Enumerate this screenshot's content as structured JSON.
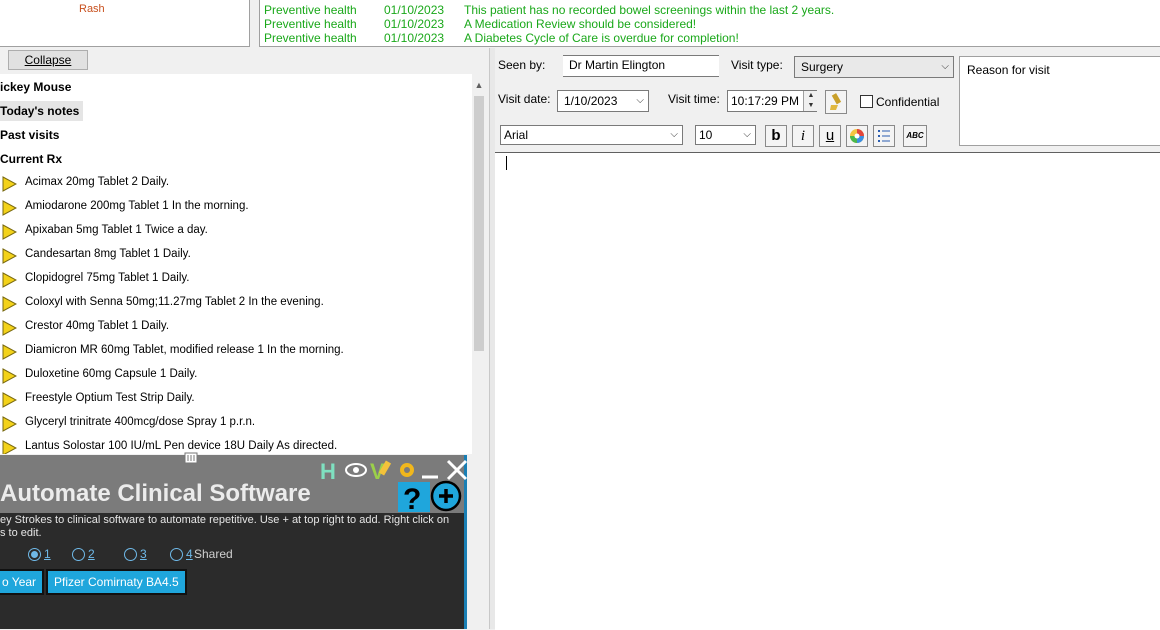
{
  "rash": "Rash",
  "reminders": [
    {
      "category": "Preventive health",
      "date": "01/10/2023",
      "message": "This patient has no recorded bowel screenings within the last 2 years."
    },
    {
      "category": "Preventive health",
      "date": "01/10/2023",
      "message": "A Medication Review should be considered!"
    },
    {
      "category": "Preventive health",
      "date": "01/10/2023",
      "message": "A Diabetes Cycle of Care is overdue for completion!"
    }
  ],
  "collapse_label": "Collapse",
  "tree": {
    "patient": "ickey Mouse",
    "todays_notes": "Today's notes",
    "past_visits": "Past visits",
    "current_rx": "Current Rx",
    "rx": [
      "Acimax 20mg Tablet 2 Daily.",
      "Amiodarone 200mg Tablet 1 In the morning.",
      "Apixaban 5mg Tablet 1 Twice a day.",
      "Candesartan 8mg Tablet 1 Daily.",
      "Clopidogrel 75mg Tablet 1 Daily.",
      "Coloxyl with Senna 50mg;11.27mg Tablet 2 In the evening.",
      "Crestor 40mg Tablet 1 Daily.",
      "Diamicron MR 60mg Tablet, modified release 1 In the morning.",
      "Duloxetine 60mg Capsule 1 Daily.",
      "Freestyle Optium Test Strip Daily.",
      "Glyceryl trinitrate 400mcg/dose Spray 1 p.r.n.",
      "Lantus Solostar 100 IU/mL Pen device 18U Daily As directed."
    ]
  },
  "automate": {
    "title": "Automate Clinical Software",
    "desc_line1": "ey Strokes to clinical software to automate repetitive. Use + at top right to add. Right click on",
    "desc_line2": "s to edit.",
    "radios": [
      {
        "num": "1",
        "extra": "",
        "selected": true
      },
      {
        "num": "2",
        "extra": "",
        "selected": false
      },
      {
        "num": "3",
        "extra": "",
        "selected": false
      },
      {
        "num": "4",
        "extra": " Shared",
        "selected": false
      }
    ],
    "buttons": [
      "o Year",
      "Pfizer Comirnaty BA4.5"
    ],
    "icons": [
      "h-icon",
      "eye-icon",
      "v-icon",
      "gear-icon",
      "minimize-icon",
      "close-icon",
      "help-icon",
      "add-icon"
    ]
  },
  "form": {
    "seen_by_label": "Seen by:",
    "seen_by_value": "Dr Martin Elington",
    "visit_type_label": "Visit type:",
    "visit_type_value": "Surgery",
    "visit_date_label": "Visit date:",
    "visit_date_value": "1/10/2023",
    "visit_time_label": "Visit time:",
    "visit_time_value": "10:17:29 PM",
    "confidential_label": "Confidential",
    "reason_label": "Reason for visit",
    "font_value": "Arial",
    "size_value": "10",
    "bold": "b",
    "italic": "i",
    "underline": "u",
    "spell": "ABC"
  }
}
